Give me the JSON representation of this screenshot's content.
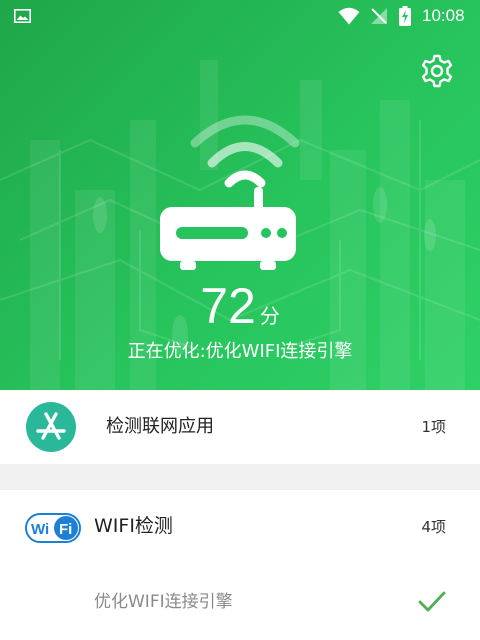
{
  "status_bar": {
    "time": "10:08",
    "icons": [
      "image-icon",
      "wifi-icon",
      "no-signal-icon",
      "battery-charging-icon"
    ]
  },
  "header": {
    "settings_icon": "gear-icon",
    "illustration": "wifi-router-icon",
    "score_value": "72",
    "score_unit": "分",
    "status_text": "正在优化:优化WIFI连接引擎"
  },
  "items": [
    {
      "icon": "app-store-icon",
      "label": "检测联网应用",
      "count": "1项"
    },
    {
      "icon": "wifi-logo-icon",
      "label": "WIFI检测",
      "count": "4项"
    }
  ],
  "sub_items": [
    {
      "label": "优化WIFI连接引擎",
      "state_icon": "check-icon"
    }
  ],
  "colors": {
    "primary_green": "#27c35c",
    "app_icon_teal": "#2bb89a",
    "wifi_logo_blue": "#1e7fd6",
    "check_green": "#4caf50"
  }
}
